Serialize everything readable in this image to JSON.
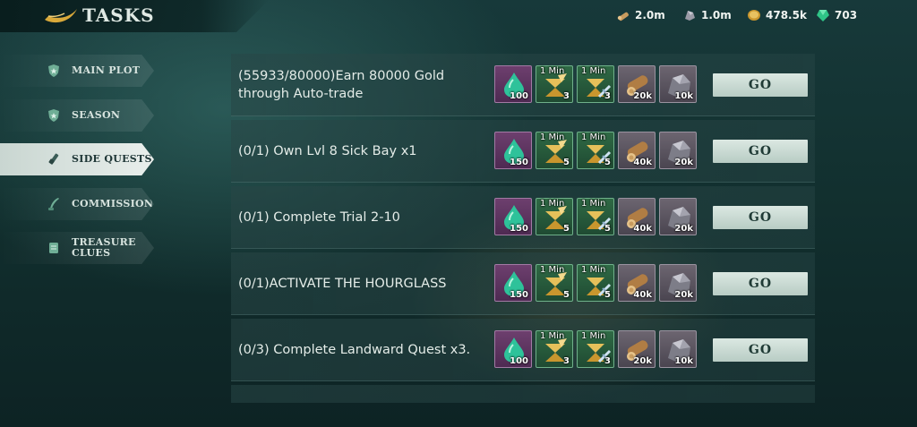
{
  "header": {
    "title": "TASKS"
  },
  "resources": [
    {
      "icon": "wood-icon",
      "value": "2.0m"
    },
    {
      "icon": "stone-icon",
      "value": "1.0m"
    },
    {
      "icon": "gold-coin-icon",
      "value": "478.5k"
    },
    {
      "icon": "gem-icon",
      "value": "703"
    }
  ],
  "sidebar": {
    "items": [
      {
        "label": "MAIN PLOT",
        "icon": "shield-icon",
        "active": false
      },
      {
        "label": "SEASON",
        "icon": "shield-icon",
        "active": false
      },
      {
        "label": "SIDE QUESTS",
        "icon": "spyglass-icon",
        "active": true
      },
      {
        "label": "COMMISSIONS",
        "icon": "quill-icon",
        "active": false
      },
      {
        "label": "TREASURE",
        "label2": "CLUES",
        "icon": "scroll-icon",
        "active": false
      }
    ]
  },
  "tasks": [
    {
      "desc": "(55933/80000)Earn 80000 Gold through Auto-trade",
      "drop": "100",
      "speed1_label": "1 Min",
      "speed1": "3",
      "speed2_label": "1 Min",
      "speed2": "3",
      "wood": "20k",
      "stone": "10k",
      "go": "GO"
    },
    {
      "desc": "(0/1) Own Lvl 8 Sick Bay x1",
      "drop": "150",
      "speed1_label": "1 Min",
      "speed1": "5",
      "speed2_label": "1 Min",
      "speed2": "5",
      "wood": "40k",
      "stone": "20k",
      "go": "GO"
    },
    {
      "desc": "(0/1) Complete Trial 2-10",
      "drop": "150",
      "speed1_label": "1 Min",
      "speed1": "5",
      "speed2_label": "1 Min",
      "speed2": "5",
      "wood": "40k",
      "stone": "20k",
      "go": "GO"
    },
    {
      "desc": "(0/1)ACTIVATE THE HOURGLASS",
      "drop": "150",
      "speed1_label": "1 Min",
      "speed1": "5",
      "speed2_label": "1 Min",
      "speed2": "5",
      "wood": "40k",
      "stone": "20k",
      "go": "GO"
    },
    {
      "desc": "(0/3) Complete Landward Quest x3.",
      "drop": "100",
      "speed1_label": "1 Min",
      "speed1": "3",
      "speed2_label": "1 Min",
      "speed2": "3",
      "wood": "20k",
      "stone": "10k",
      "go": "GO"
    }
  ]
}
